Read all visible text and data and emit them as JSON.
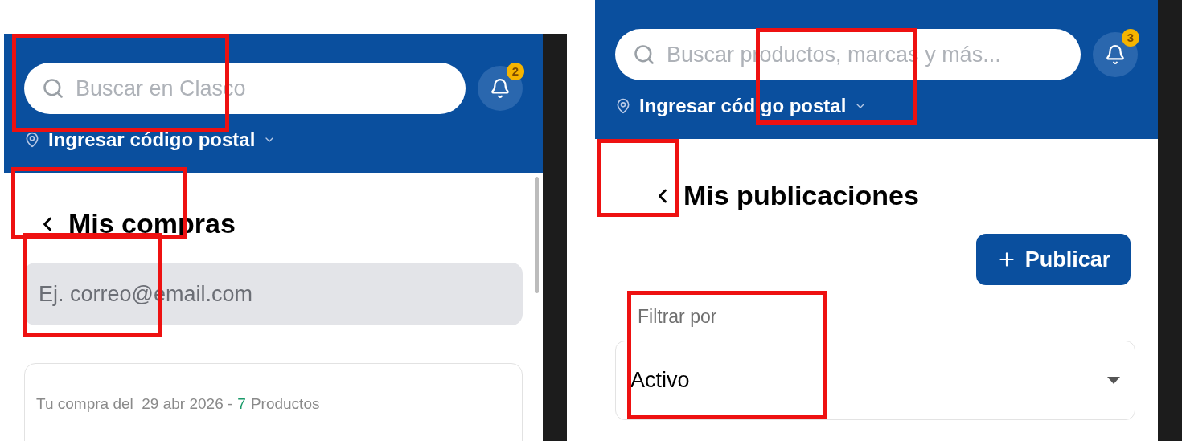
{
  "screens": [
    {
      "kind": "purchases",
      "search": {
        "placeholder": "Buscar en Clasco"
      },
      "notifications": {
        "count": "2"
      },
      "location": {
        "label": "Ingresar código postal"
      },
      "page_title": "Mis compras",
      "email_field": {
        "placeholder": "Ej. correo@email.com"
      },
      "purchase_card": {
        "date_text": "Tu compra del  29 abr 2026 -",
        "product_count": "7",
        "product_label": "Productos"
      }
    },
    {
      "kind": "publications",
      "search": {
        "placeholder": "Buscar productos, marcas y más..."
      },
      "notifications": {
        "count": "3"
      },
      "location": {
        "label": "Ingresar código postal"
      },
      "page_title": "Mis publicaciones",
      "publish_button": {
        "label": "Publicar"
      },
      "filter": {
        "label": "Filtrar por",
        "value": "Activo"
      }
    }
  ],
  "annotations": [
    {
      "color": "#ee1111"
    },
    {
      "color": "#ee1111"
    },
    {
      "color": "#ee1111"
    },
    {
      "color": "#ee1111"
    },
    {
      "color": "#ee1111"
    },
    {
      "color": "#ee1111"
    }
  ]
}
